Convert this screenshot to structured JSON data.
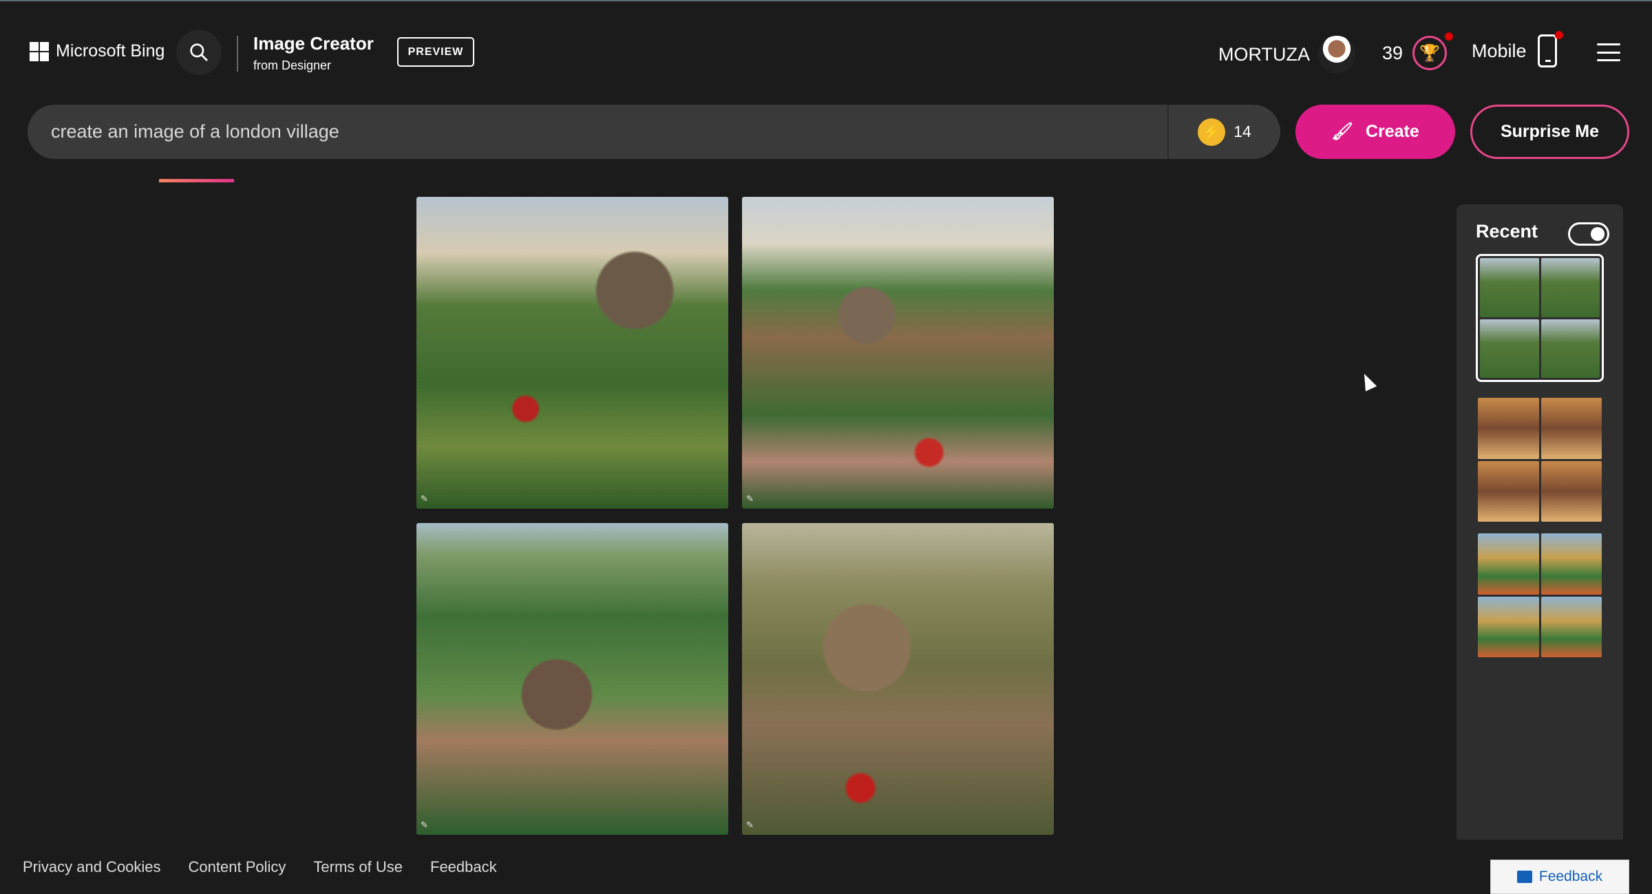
{
  "header": {
    "brand": "Microsoft Bing",
    "title": "Image Creator",
    "subtitle": "from Designer",
    "preview": "PREVIEW",
    "username": "MORTUZA",
    "points": "39",
    "mobile": "Mobile"
  },
  "search": {
    "value": "create an image of a london village",
    "boosts": "14",
    "create": "Create",
    "surprise": "Surprise Me"
  },
  "results": {
    "images": [
      {
        "alt": "London village 1"
      },
      {
        "alt": "London village 2"
      },
      {
        "alt": "London village 3"
      },
      {
        "alt": "London village 4"
      }
    ]
  },
  "recent": {
    "title": "Recent",
    "toggle_on": true
  },
  "footer": {
    "links": [
      "Privacy and Cookies",
      "Content Policy",
      "Terms of Use",
      "Feedback"
    ],
    "feedback_button": "Feedback"
  },
  "colors": {
    "accent": "#dc1b87",
    "background": "#1b1b1b"
  }
}
